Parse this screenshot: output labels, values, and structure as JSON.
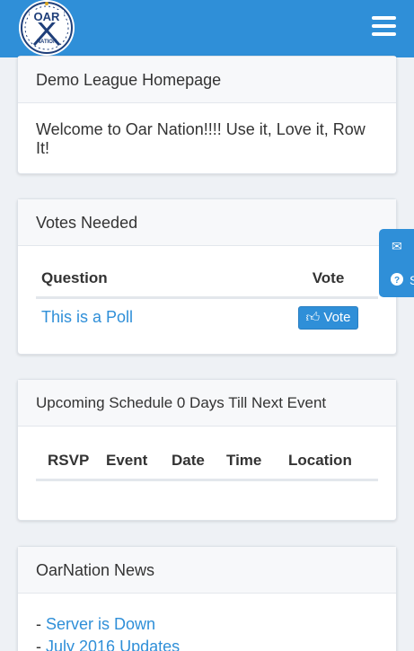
{
  "header": {
    "logo_text": "OAR",
    "logo_subtext": "NATION",
    "menu_icon": "hamburger-icon"
  },
  "panels": {
    "home": {
      "title": "Demo League Homepage",
      "body": "Welcome to Oar Nation!!!! Use it, Love it, Row It!"
    },
    "votes": {
      "title": "Votes Needed",
      "columns": [
        "Question",
        "Vote"
      ],
      "rows": [
        {
          "question": "This is a Poll",
          "vote_label": "Vote"
        }
      ]
    },
    "schedule": {
      "title": "Upcoming Schedule 0 Days Till Next Event",
      "columns": [
        "RSVP",
        "Event",
        "Date",
        "Time",
        "Location"
      ]
    },
    "news": {
      "title": "OarNation News",
      "items": [
        {
          "prefix": "-",
          "link": "Server is Down"
        },
        {
          "prefix": "-",
          "link": "July 2016 Updates"
        }
      ]
    }
  },
  "side_tab": {
    "icons": [
      "envelope-icon",
      "question-circle-icon"
    ],
    "partial_text": "S"
  },
  "colors": {
    "primary": "#2f8fd8",
    "background": "#eef1f5"
  }
}
